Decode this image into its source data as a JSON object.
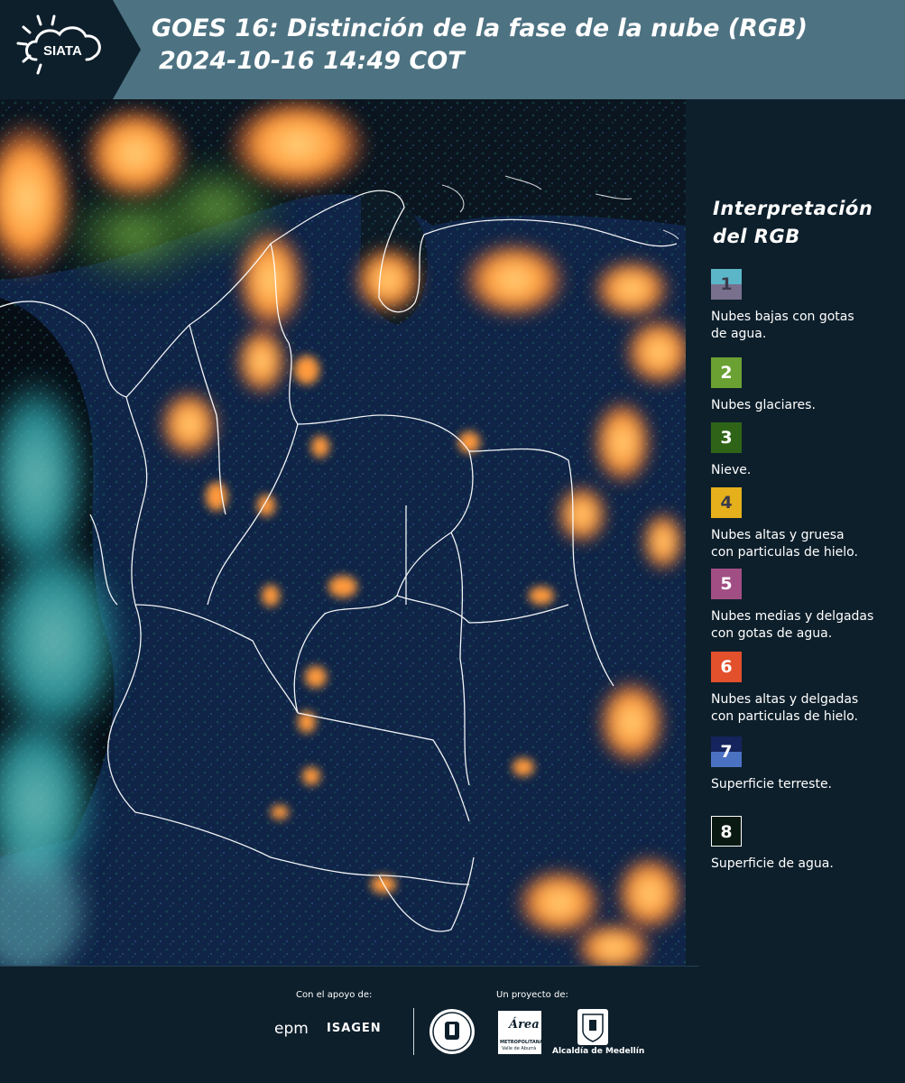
{
  "header": {
    "logo_text": "SIATA",
    "title_line1": "GOES 16: Distinción de la fase de la nube (RGB)",
    "title_line2": "2024-10-16 14:49 COT",
    "background": "#4d7282"
  },
  "legend": {
    "title_line1": "Interpretación",
    "title_line2": "del RGB",
    "items": [
      {
        "number": "1",
        "label_line1": "Nubes bajas con gotas",
        "label_line2": "de agua.",
        "color_top": "#5bb6c8",
        "color_bottom": "#79708e"
      },
      {
        "number": "2",
        "label_line1": "Nubes glaciares.",
        "label_line2": "",
        "color_top": "#6aa132",
        "color_bottom": "#6aa132"
      },
      {
        "number": "3",
        "label_line1": "Nieve.",
        "label_line2": "",
        "color_top": "#2f6418",
        "color_bottom": "#2f6418"
      },
      {
        "number": "4",
        "label_line1": "Nubes altas y gruesa",
        "label_line2": "con particulas de hielo.",
        "color_top": "#e5b01c",
        "color_bottom": "#e5b01c"
      },
      {
        "number": "5",
        "label_line1": "Nubes medias y delgadas",
        "label_line2": "con gotas de agua.",
        "color_top": "#a04e84",
        "color_bottom": "#a04e84"
      },
      {
        "number": "6",
        "label_line1": "Nubes altas y delgadas",
        "label_line2": "con particulas de hielo.",
        "color_top": "#e3502c",
        "color_bottom": "#e3502c"
      },
      {
        "number": "7",
        "label_line1": "Superficie terreste.",
        "label_line2": "",
        "color_top": "#15245c",
        "color_bottom": "#4b72c2"
      },
      {
        "number": "8",
        "label_line1": "Superficie de agua.",
        "label_line2": "",
        "color_top": "#0a1a12",
        "color_bottom": "#0a1a12"
      }
    ]
  },
  "footer": {
    "support_label": "Con el apoyo de:",
    "project_label": "Un proyecto de:",
    "epm_text": "epm",
    "isagen_text": "ISAGEN",
    "area_text": "Área",
    "metropolitana_text": "METROPOLITANA",
    "valle_text": "Valle de Aburrá",
    "alcaldia_text": "Alcaldía de Medellín"
  }
}
